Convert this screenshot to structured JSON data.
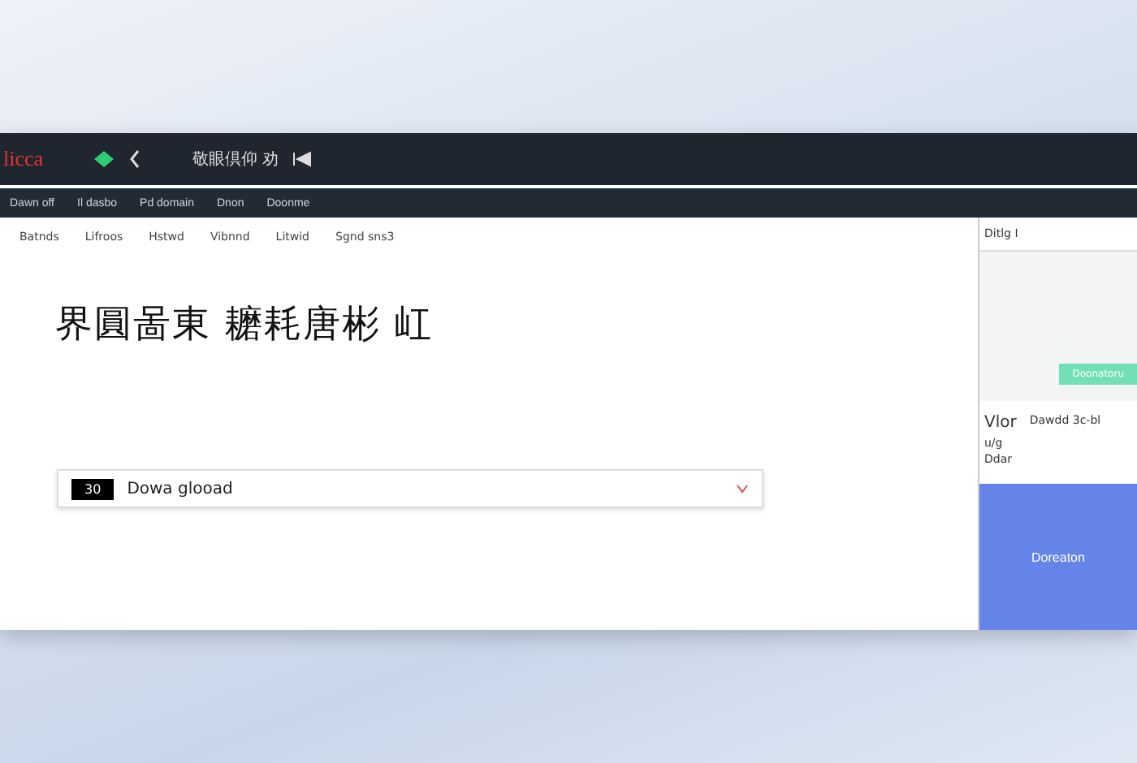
{
  "header": {
    "brand": "licca",
    "title": "敬眼倶仰 劝"
  },
  "toolbar": [
    "Dawn off",
    "Il dasbo",
    "Pd domain",
    "Dnon",
    "Doonme"
  ],
  "menu": [
    "Batnds",
    "Lifroos",
    "Hstwd",
    "Vibnnd",
    "Litwid",
    "Sgnd sns3"
  ],
  "main": {
    "heading": "界圓啚東 耱耗唐彬 屸",
    "bar": {
      "badge": "30",
      "label": "Dowa glooad"
    }
  },
  "side": {
    "title": "Ditlg I",
    "tag": "Doonatoru",
    "value_label": "Vlor",
    "value": "Dawdd 3c-bl",
    "lines": [
      "u/g",
      "Ddar"
    ],
    "button": "Doreaton"
  }
}
